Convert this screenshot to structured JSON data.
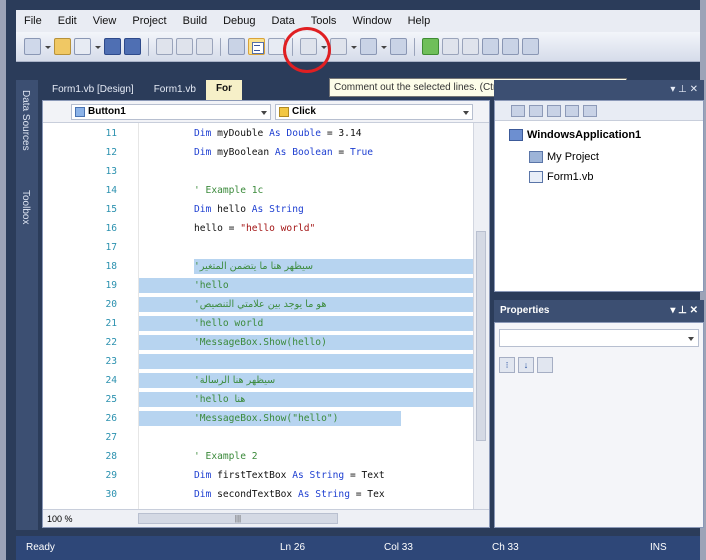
{
  "menu": [
    "File",
    "Edit",
    "View",
    "Project",
    "Build",
    "Debug",
    "Data",
    "Tools",
    "Window",
    "Help"
  ],
  "tabs": [
    {
      "label": "Form1.vb [Design]"
    },
    {
      "label": "Form1.vb"
    },
    {
      "label": "For"
    }
  ],
  "tooltip": "Comment out the selected lines. (Ctrl+K, Ctrl+C)",
  "sidebar": [
    "Data Sources",
    "Toolbox"
  ],
  "editor": {
    "object_combo": "Button1",
    "event_combo": "Click",
    "zoom": "100 %",
    "lines": [
      {
        "n": "11",
        "tokens": [
          [
            "kw",
            "Dim "
          ],
          [
            "tx",
            "myDouble "
          ],
          [
            "kw",
            "As Double"
          ],
          [
            "tx",
            " = 3.14"
          ]
        ]
      },
      {
        "n": "12",
        "tokens": [
          [
            "kw",
            "Dim "
          ],
          [
            "tx",
            "myBoolean "
          ],
          [
            "kw",
            "As Boolean"
          ],
          [
            "tx",
            " = "
          ],
          [
            "kw",
            "True"
          ]
        ]
      },
      {
        "n": "13",
        "tokens": []
      },
      {
        "n": "14",
        "tokens": [
          [
            "cm",
            "' Example 1c"
          ]
        ]
      },
      {
        "n": "15",
        "tokens": [
          [
            "kw",
            "Dim "
          ],
          [
            "tx",
            "hello "
          ],
          [
            "kw",
            "As String"
          ]
        ]
      },
      {
        "n": "16",
        "tokens": [
          [
            "tx",
            "hello = "
          ],
          [
            "str",
            "\"hello world\""
          ]
        ]
      },
      {
        "n": "17",
        "tokens": []
      },
      {
        "n": "18",
        "tokens": [
          [
            "cm",
            "'"
          ],
          [
            "ar",
            "سيظهر هنا ما يتضمن المتغير"
          ]
        ],
        "sel": [
          151,
          324
        ]
      },
      {
        "n": "19",
        "tokens": [
          [
            "cm",
            "'hello"
          ]
        ],
        "sel": [
          96,
          334
        ]
      },
      {
        "n": "20",
        "tokens": [
          [
            "cm",
            "'"
          ],
          [
            "ar",
            "هو ما يوجد بين علامتي التنصيص"
          ]
        ],
        "sel": [
          96,
          334
        ]
      },
      {
        "n": "21",
        "tokens": [
          [
            "cm",
            "'hello world"
          ]
        ],
        "sel": [
          96,
          334
        ]
      },
      {
        "n": "22",
        "tokens": [
          [
            "cm",
            "'MessageBox.Show(hello)"
          ]
        ],
        "sel": [
          96,
          334
        ]
      },
      {
        "n": "23",
        "tokens": [],
        "sel": [
          96,
          334
        ]
      },
      {
        "n": "24",
        "tokens": [
          [
            "cm",
            "'"
          ],
          [
            "ar",
            "سيظهر هنا الرسالة"
          ]
        ],
        "sel": [
          96,
          334
        ]
      },
      {
        "n": "25",
        "tokens": [
          [
            "cm",
            "'hello "
          ],
          [
            "ar",
            "هنا"
          ]
        ],
        "sel": [
          96,
          334
        ]
      },
      {
        "n": "26",
        "tokens": [
          [
            "cm",
            "'MessageBox.Show(\"hello\")"
          ]
        ],
        "sel": [
          96,
          262
        ]
      },
      {
        "n": "27",
        "tokens": []
      },
      {
        "n": "28",
        "tokens": [
          [
            "cm",
            "' Example 2"
          ]
        ]
      },
      {
        "n": "29",
        "tokens": [
          [
            "kw",
            "Dim "
          ],
          [
            "tx",
            "firstTextBox "
          ],
          [
            "kw",
            "As String"
          ],
          [
            "tx",
            " = Text"
          ]
        ]
      },
      {
        "n": "30",
        "tokens": [
          [
            "kw",
            "Dim "
          ],
          [
            "tx",
            "secondTextBox "
          ],
          [
            "kw",
            "As String"
          ],
          [
            "tx",
            " = Tex"
          ]
        ]
      }
    ]
  },
  "solution": {
    "root": "WindowsApplication1",
    "items": [
      "My Project",
      "Form1.vb"
    ]
  },
  "properties": {
    "title": "Properties"
  },
  "status": {
    "state": "Ready",
    "ln": "Ln 26",
    "col": "Col 33",
    "ch": "Ch 33",
    "mode": "INS"
  }
}
